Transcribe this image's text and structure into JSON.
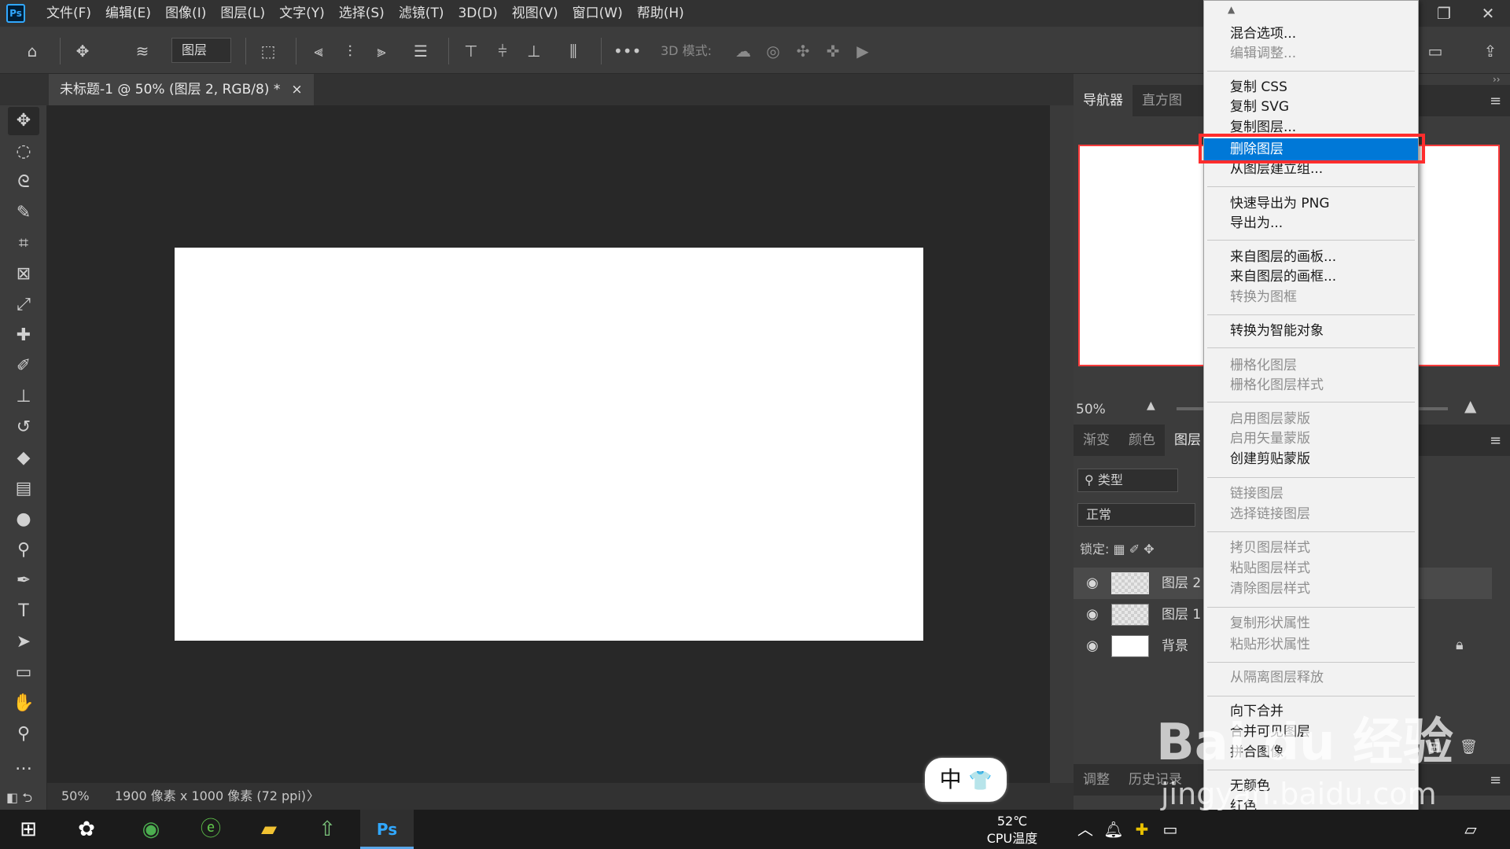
{
  "app": {
    "logo": "Ps"
  },
  "menubar": {
    "items": [
      "文件(F)",
      "编辑(E)",
      "图像(I)",
      "图层(L)",
      "文字(Y)",
      "选择(S)",
      "滤镜(T)",
      "3D(D)",
      "视图(V)",
      "窗口(W)",
      "帮助(H)"
    ]
  },
  "options_bar": {
    "layer_select_value": "图层",
    "more_label": "•••",
    "mode_3d_label": "3D 模式:"
  },
  "document_tab": {
    "title": "未标题-1 @ 50% (图层 2, RGB/8) *",
    "close": "×"
  },
  "status_bar": {
    "zoom": "50%",
    "doc_info": "1900 像素 x 1000 像素 (72 ppi)",
    "arrow": "〉"
  },
  "panels": {
    "nav_tabs": [
      "导航器",
      "直方图"
    ],
    "nav_zoom": "50%",
    "layer_group_tabs": [
      "渐变",
      "颜色",
      "图层"
    ],
    "layer_filter": "类型",
    "blend_mode": "正常",
    "lock_label": "锁定:",
    "layers": [
      {
        "name": "图层 2",
        "selected": true,
        "thumb": "transparent"
      },
      {
        "name": "图层 1",
        "selected": false,
        "thumb": "transparent"
      },
      {
        "name": "背景",
        "selected": false,
        "thumb": "white"
      }
    ],
    "bottom_tabs": [
      "调整",
      "历史记录"
    ]
  },
  "context_menu": {
    "scroll_up": "▲",
    "scroll_down": "▼",
    "highlight_color": "#0078d7",
    "groups": [
      [
        {
          "label": "混合选项...",
          "enabled": true
        },
        {
          "label": "编辑调整...",
          "enabled": false
        }
      ],
      [
        {
          "label": "复制 CSS",
          "enabled": true
        },
        {
          "label": "复制 SVG",
          "enabled": true
        },
        {
          "label": "复制图层...",
          "enabled": true
        },
        {
          "label": "删除图层",
          "enabled": true,
          "highlighted": true
        },
        {
          "label": "从图层建立组...",
          "enabled": true
        }
      ],
      [
        {
          "label": "快速导出为 PNG",
          "enabled": true
        },
        {
          "label": "导出为...",
          "enabled": true
        }
      ],
      [
        {
          "label": "来自图层的画板...",
          "enabled": true
        },
        {
          "label": "来自图层的画框...",
          "enabled": true
        },
        {
          "label": "转换为图框",
          "enabled": false
        }
      ],
      [
        {
          "label": "转换为智能对象",
          "enabled": true
        }
      ],
      [
        {
          "label": "栅格化图层",
          "enabled": false
        },
        {
          "label": "栅格化图层样式",
          "enabled": false
        }
      ],
      [
        {
          "label": "启用图层蒙版",
          "enabled": false
        },
        {
          "label": "启用矢量蒙版",
          "enabled": false
        },
        {
          "label": "创建剪贴蒙版",
          "enabled": true
        }
      ],
      [
        {
          "label": "链接图层",
          "enabled": false
        },
        {
          "label": "选择链接图层",
          "enabled": false
        }
      ],
      [
        {
          "label": "拷贝图层样式",
          "enabled": false
        },
        {
          "label": "粘贴图层样式",
          "enabled": false
        },
        {
          "label": "清除图层样式",
          "enabled": false
        }
      ],
      [
        {
          "label": "复制形状属性",
          "enabled": false
        },
        {
          "label": "粘贴形状属性",
          "enabled": false
        }
      ],
      [
        {
          "label": "从隔离图层释放",
          "enabled": false
        }
      ],
      [
        {
          "label": "向下合并",
          "enabled": true
        },
        {
          "label": "合并可见图层",
          "enabled": true
        },
        {
          "label": "拼合图像",
          "enabled": true
        }
      ],
      [
        {
          "label": "无颜色",
          "enabled": true
        },
        {
          "label": "红色",
          "enabled": true
        }
      ]
    ]
  },
  "ime": {
    "mode": "中",
    "icon": "shirt-icon"
  },
  "taskbar": {
    "cpu_temp": "52℃",
    "cpu_label": "CPU温度"
  },
  "watermark": {
    "main": "Bai du 经验",
    "sub": "jingyan.baidu.com"
  }
}
